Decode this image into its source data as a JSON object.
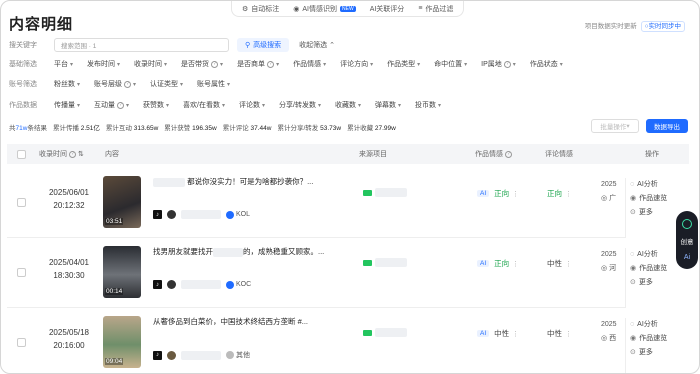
{
  "topnav": {
    "items": [
      "自动标注",
      "AI情感识别",
      "AI关联评分",
      "作品过滤"
    ],
    "badge": "NEW"
  },
  "page": {
    "title": "内容明细"
  },
  "topright": {
    "prefix": "项目数据实时更新",
    "live": "实时同步中"
  },
  "filters": {
    "keyword": {
      "label": "搜关键字",
      "scope": "搜索范围 · 1",
      "placeholder": "",
      "advanced": "高级搜索",
      "collapse": "收起筛选"
    },
    "basic": {
      "label": "基础筛选",
      "items": [
        "平台",
        "发布时间",
        "收录时间",
        "是否带货",
        "是否商单",
        "作品情感",
        "评论方向",
        "作品类型",
        "命中位置",
        "IP属地",
        "作品状态"
      ]
    },
    "account": {
      "label": "账号筛选",
      "items": [
        "粉丝数",
        "账号层级",
        "认证类型",
        "账号属性"
      ]
    },
    "data": {
      "label": "作品数据",
      "items": [
        "传播量",
        "互动量",
        "获赞数",
        "喜欢/在看数",
        "评论数",
        "分享/转发数",
        "收藏数",
        "弹幕数",
        "投币数"
      ]
    }
  },
  "stats": {
    "total_prefix": "共",
    "total_count": "71w",
    "total_suffix": "条结果",
    "items": [
      {
        "label": "累计传播",
        "value": "2.51亿"
      },
      {
        "label": "累计互动",
        "value": "313.65w"
      },
      {
        "label": "累计获赞",
        "value": "196.35w"
      },
      {
        "label": "累计评论",
        "value": "37.44w"
      },
      {
        "label": "累计分享/转发",
        "value": "53.73w"
      },
      {
        "label": "累计收藏",
        "value": "27.99w"
      }
    ],
    "batch": "批量操作",
    "export": "数据导出"
  },
  "table": {
    "headers": {
      "time": "收录时间",
      "content": "内容",
      "source": "来源项目",
      "emotion": "作品情感",
      "comment": "评论情感",
      "ops": "操作"
    },
    "rows": [
      {
        "date": "2025/06/01",
        "clock": "20:12:32",
        "duration": "03:51",
        "title": "都说你没实力！可是为啥都抄袭你？...",
        "account_type": "KOL",
        "emotion": "正向",
        "comment": "正向",
        "extra_year": "2025",
        "extra_loc": "广",
        "ops": [
          "AI分析",
          "作品速览",
          "更多"
        ]
      },
      {
        "date": "2025/04/01",
        "clock": "18:30:30",
        "duration": "00:14",
        "title": "找男朋友就要找开",
        "title2": "的，成熟稳重又顾家。...",
        "account_type": "KOC",
        "emotion": "正向",
        "comment": "中性",
        "extra_year": "2025",
        "extra_loc": "河",
        "ops": [
          "AI分析",
          "作品速览",
          "更多"
        ]
      },
      {
        "date": "2025/05/18",
        "clock": "20:16:00",
        "duration": "09:04",
        "title": "从奢侈品到白菜价，中国技术终结西方垄断 #...",
        "account_type": "其他",
        "emotion": "中性",
        "comment": "中性",
        "extra_year": "2025",
        "extra_loc": "西",
        "ops": [
          "AI分析",
          "作品速览",
          "更多"
        ]
      }
    ]
  },
  "float": {
    "label": "创意",
    "ai": "Ai"
  },
  "colors": {
    "accent": "#1f6bff",
    "positive": "#17a34a"
  }
}
